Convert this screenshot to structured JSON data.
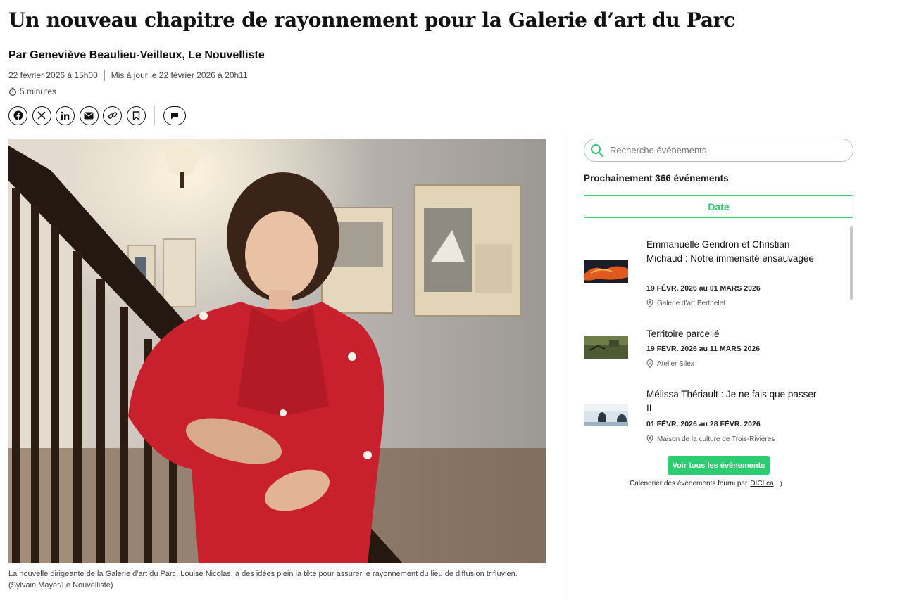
{
  "article": {
    "headline": "Un nouveau chapitre de rayonnement pour la Galerie d’art du Parc",
    "byline": "Par Geneviève Beaulieu-Veilleux, Le Nouvelliste",
    "published": "22 février 2026 à 15h00",
    "updated": "Mis à jour le 22 février 2026 à 20h11",
    "read_time": "5 minutes",
    "caption_line1": "La nouvelle dirigeante de la Galerie d'art du Parc, Louise Nicolas, a des idées plein la tête pour assurer le rayonnement du lieu de diffusion trifluvien.",
    "caption_line2": "(Sylvain Mayer/Le Nouvelliste)"
  },
  "share_icons": [
    "facebook-icon",
    "x-icon",
    "linkedin-icon",
    "email-icon",
    "link-icon",
    "bookmark-icon",
    "comment-icon"
  ],
  "sidebar": {
    "search_placeholder": "Recherche événements",
    "count_label": "Prochainement 366 événements",
    "date_button": "Date",
    "events": [
      {
        "title": "Emmanuelle Gendron et Christian Michaud : Notre immensité ensauvagée",
        "dates": "19 FÉVR. 2026 au 01 MARS 2026",
        "venue": "Galerie d'art Berthelet"
      },
      {
        "title": "Territoire parcellé",
        "dates": "19 FÉVR. 2026 au 11 MARS 2026",
        "venue": "Atelier Silex"
      },
      {
        "title": "Mélissa Thériault : Je ne fais que passer II",
        "dates": "01 FÉVR. 2026 au 28 FÉVR. 2026",
        "venue": "Maison de la culture de Trois-Rivières"
      }
    ],
    "all_events_button": "Voir tous les événements",
    "provider_text": "Calendrier des événements fourni par",
    "provider_link": "DICI.ca"
  },
  "colors": {
    "accent": "#2ecc71",
    "dress": "#c8202c"
  }
}
